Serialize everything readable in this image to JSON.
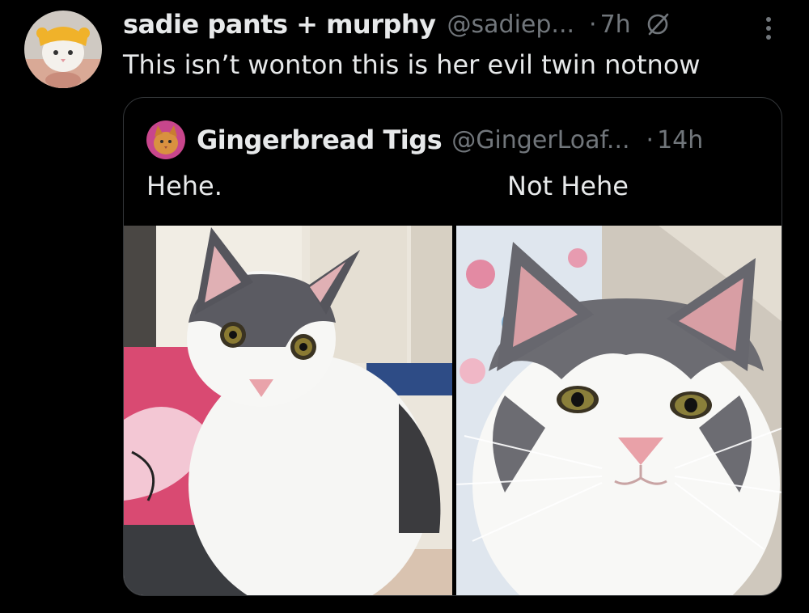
{
  "tweet": {
    "display_name": "sadie pants + murphy",
    "handle": "@sadiep...",
    "separator": "·",
    "time": "7h",
    "text": "This isn’t wonton this is her evil twin notnow"
  },
  "quoted": {
    "display_name": "Gingerbread Tigs",
    "handle": "@GingerLoaf...",
    "separator": "·",
    "time": "14h",
    "text_left": "Hehe.",
    "text_right": "Not Hehe"
  },
  "icons": {
    "grok": "grok-icon",
    "more": "more-vertical-icon"
  },
  "colors": {
    "background": "#000000",
    "primary_text": "#e7e9ea",
    "secondary_text": "#71767b",
    "border": "#333639"
  }
}
